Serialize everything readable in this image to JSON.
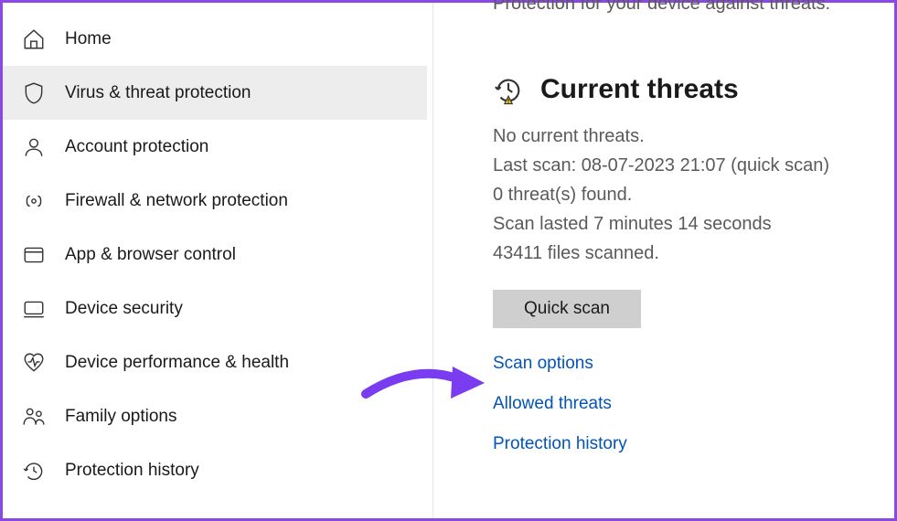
{
  "sidebar": {
    "items": [
      {
        "label": "Home"
      },
      {
        "label": "Virus & threat protection"
      },
      {
        "label": "Account protection"
      },
      {
        "label": "Firewall & network protection"
      },
      {
        "label": "App & browser control"
      },
      {
        "label": "Device security"
      },
      {
        "label": "Device performance & health"
      },
      {
        "label": "Family options"
      },
      {
        "label": "Protection history"
      }
    ]
  },
  "main": {
    "cutoff_text": "Protection for your device against threats.",
    "section_title": "Current threats",
    "status": {
      "line1": "No current threats.",
      "line2": "Last scan: 08-07-2023 21:07 (quick scan)",
      "line3": "0 threat(s) found.",
      "line4": "Scan lasted 7 minutes 14 seconds",
      "line5": "43411 files scanned."
    },
    "quick_scan_label": "Quick scan",
    "links": {
      "scan_options": "Scan options",
      "allowed_threats": "Allowed threats",
      "protection_history": "Protection history"
    }
  }
}
